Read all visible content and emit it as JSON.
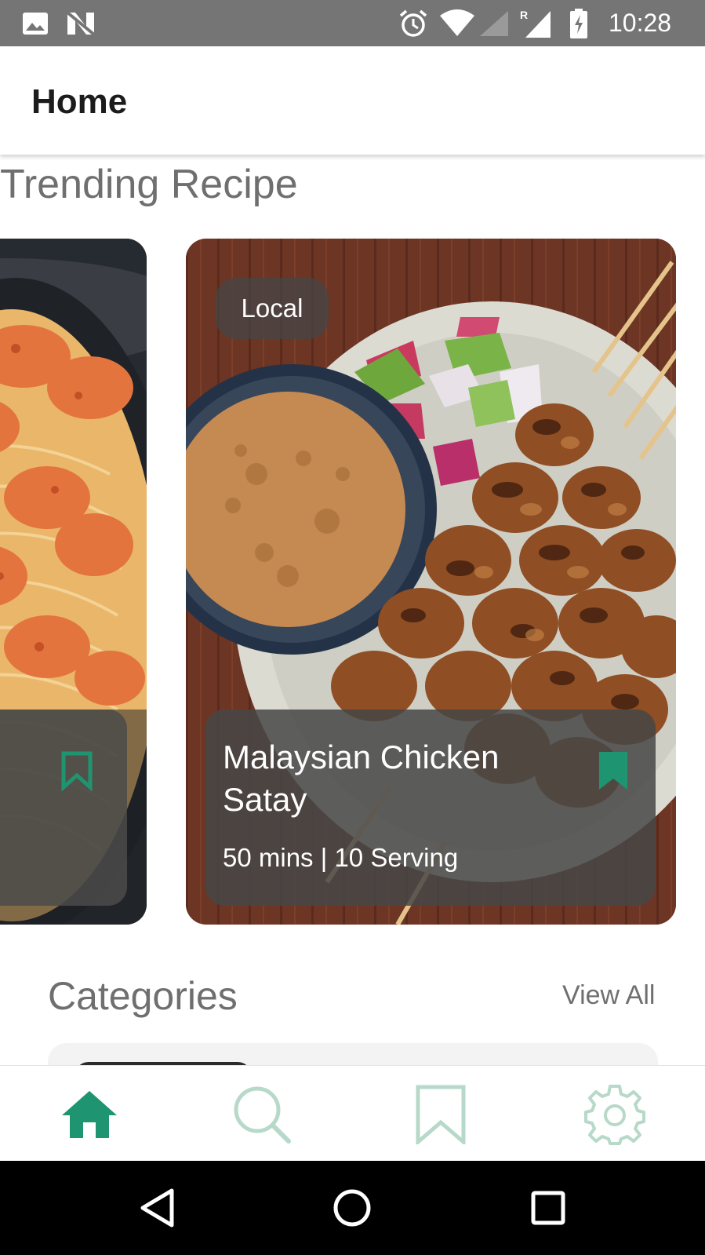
{
  "status_bar": {
    "time": "10:28",
    "icons": [
      "image-icon",
      "n-icon",
      "alarm-icon",
      "wifi-icon",
      "signal-icon",
      "signal-roaming-icon",
      "battery-charging-icon"
    ]
  },
  "header": {
    "title": "Home"
  },
  "trending": {
    "title": "Trending Recipe",
    "cards": [
      {
        "tag": "Local",
        "title": "Malaysian Chicken Satay",
        "meta": "50 mins | 10 Serving",
        "bookmarked": true
      }
    ]
  },
  "categories": {
    "title": "Categories",
    "view_all": "View All"
  },
  "bottom_nav": {
    "items": [
      {
        "icon": "home-icon",
        "active": true
      },
      {
        "icon": "search-icon",
        "active": false
      },
      {
        "icon": "bookmark-icon",
        "active": false
      },
      {
        "icon": "gear-icon",
        "active": false
      }
    ]
  },
  "colors": {
    "accent": "#1f9470",
    "accent_light": "#b7d9c9",
    "status_bar": "#757575",
    "text_gray": "#6f6f6f"
  }
}
